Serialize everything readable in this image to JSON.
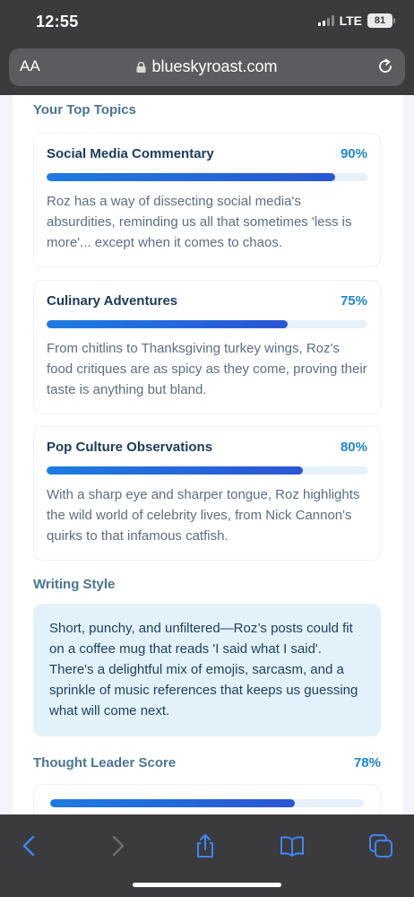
{
  "status": {
    "time": "12:55",
    "network": "LTE",
    "battery": "81"
  },
  "browser": {
    "text_size_label": "AA",
    "url": "blueskyroast.com"
  },
  "sections": {
    "top_topics_title": "Your Top Topics",
    "writing_style_title": "Writing Style",
    "thought_leader_title": "Thought Leader Score"
  },
  "topics": [
    {
      "name": "Social Media Commentary",
      "percent_label": "90%",
      "percent_value": 90,
      "description": "Roz has a way of dissecting social media's absurdities, reminding us all that sometimes 'less is more'... except when it comes to chaos."
    },
    {
      "name": "Culinary Adventures",
      "percent_label": "75%",
      "percent_value": 75,
      "description": "From chitlins to Thanksgiving turkey wings, Roz's food critiques are as spicy as they come, proving their taste is anything but bland."
    },
    {
      "name": "Pop Culture Observations",
      "percent_label": "80%",
      "percent_value": 80,
      "description": "With a sharp eye and sharper tongue, Roz highlights the wild world of celebrity lives, from Nick Cannon's quirks to that infamous catfish."
    }
  ],
  "writing_style": {
    "text": "Short, punchy, and unfiltered—Roz’s posts could fit on a coffee mug that reads 'I said what I said'. There's a delightful mix of emojis, sarcasm, and a sprinkle of music references that keeps us guessing what will come next."
  },
  "thought_leader": {
    "percent_label": "78%",
    "percent_value": 78
  },
  "toolbar": {
    "icons": [
      "back-icon",
      "forward-icon",
      "share-icon",
      "bookmarks-icon",
      "tabs-icon"
    ]
  },
  "colors": {
    "chrome": "#3b3b3d",
    "accent": "#1f86c8",
    "bar_start": "#1e7be0",
    "bar_end": "#2a56d3",
    "style_box_bg": "#e3f1fa"
  }
}
